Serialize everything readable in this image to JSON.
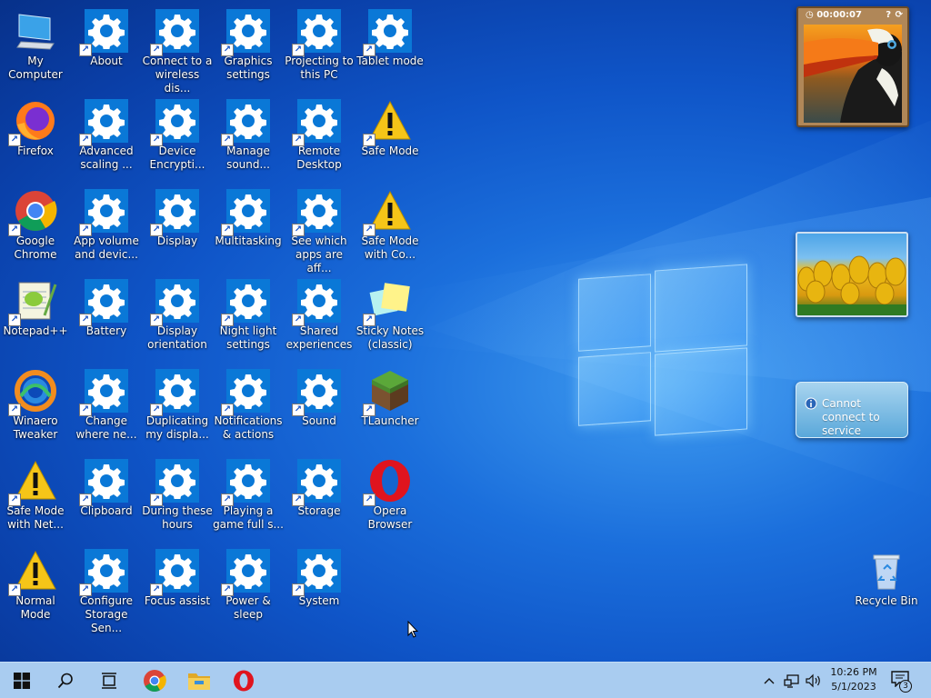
{
  "desktop": {
    "icons": [
      {
        "label": "My Computer",
        "type": "computer"
      },
      {
        "label": "About",
        "type": "settings"
      },
      {
        "label": "Connect to a wireless dis...",
        "type": "settings"
      },
      {
        "label": "Graphics settings",
        "type": "settings"
      },
      {
        "label": "Projecting to this PC",
        "type": "settings"
      },
      {
        "label": "Tablet mode",
        "type": "settings"
      },
      {
        "label": "Firefox",
        "type": "firefox"
      },
      {
        "label": "Advanced scaling ...",
        "type": "settings"
      },
      {
        "label": "Device Encrypti...",
        "type": "settings"
      },
      {
        "label": "Manage sound...",
        "type": "settings"
      },
      {
        "label": "Remote Desktop",
        "type": "settings"
      },
      {
        "label": "Safe Mode",
        "type": "warning"
      },
      {
        "label": "Google Chrome",
        "type": "chrome"
      },
      {
        "label": "App volume and devic...",
        "type": "settings"
      },
      {
        "label": "Display",
        "type": "settings"
      },
      {
        "label": "Multitasking",
        "type": "settings"
      },
      {
        "label": "See which apps are aff...",
        "type": "settings"
      },
      {
        "label": "Safe Mode with Co...",
        "type": "warning"
      },
      {
        "label": "Notepad++",
        "type": "notepad"
      },
      {
        "label": "Battery",
        "type": "settings"
      },
      {
        "label": "Display orientation",
        "type": "settings"
      },
      {
        "label": "Night light settings",
        "type": "settings"
      },
      {
        "label": "Shared experiences",
        "type": "settings"
      },
      {
        "label": "Sticky Notes (classic)",
        "type": "sticky"
      },
      {
        "label": "Winaero Tweaker",
        "type": "winaero"
      },
      {
        "label": "Change where ne...",
        "type": "settings"
      },
      {
        "label": "Duplicating my displa...",
        "type": "settings"
      },
      {
        "label": "Notifications & actions",
        "type": "settings"
      },
      {
        "label": "Sound",
        "type": "settings"
      },
      {
        "label": "TLauncher",
        "type": "minecraft"
      },
      {
        "label": "Safe Mode with Net...",
        "type": "warning"
      },
      {
        "label": "Clipboard",
        "type": "settings"
      },
      {
        "label": "During these hours",
        "type": "settings"
      },
      {
        "label": "Playing a game full s...",
        "type": "settings"
      },
      {
        "label": "Storage",
        "type": "settings"
      },
      {
        "label": "Opera Browser",
        "type": "opera"
      },
      {
        "label": "Normal Mode",
        "type": "warning"
      },
      {
        "label": "Configure Storage Sen...",
        "type": "settings"
      },
      {
        "label": "Focus assist",
        "type": "settings"
      },
      {
        "label": "Power & sleep",
        "type": "settings"
      },
      {
        "label": "System",
        "type": "settings"
      }
    ],
    "recycle_bin": {
      "label": "Recycle Bin"
    }
  },
  "gadgets": {
    "clock_timer": "00:00:07",
    "weather_message": "Cannot connect to service"
  },
  "taskbar": {
    "time": "10:26 PM",
    "date": "5/1/2023",
    "notification_count": "3",
    "pinned": [
      "start-icon",
      "search-icon",
      "task-view-icon",
      "chrome-icon",
      "file-explorer-icon",
      "opera-icon"
    ]
  },
  "colors": {
    "settings_tile": "#0a78d7",
    "taskbar": "#a9ccf0",
    "warning": "#f5c518"
  }
}
